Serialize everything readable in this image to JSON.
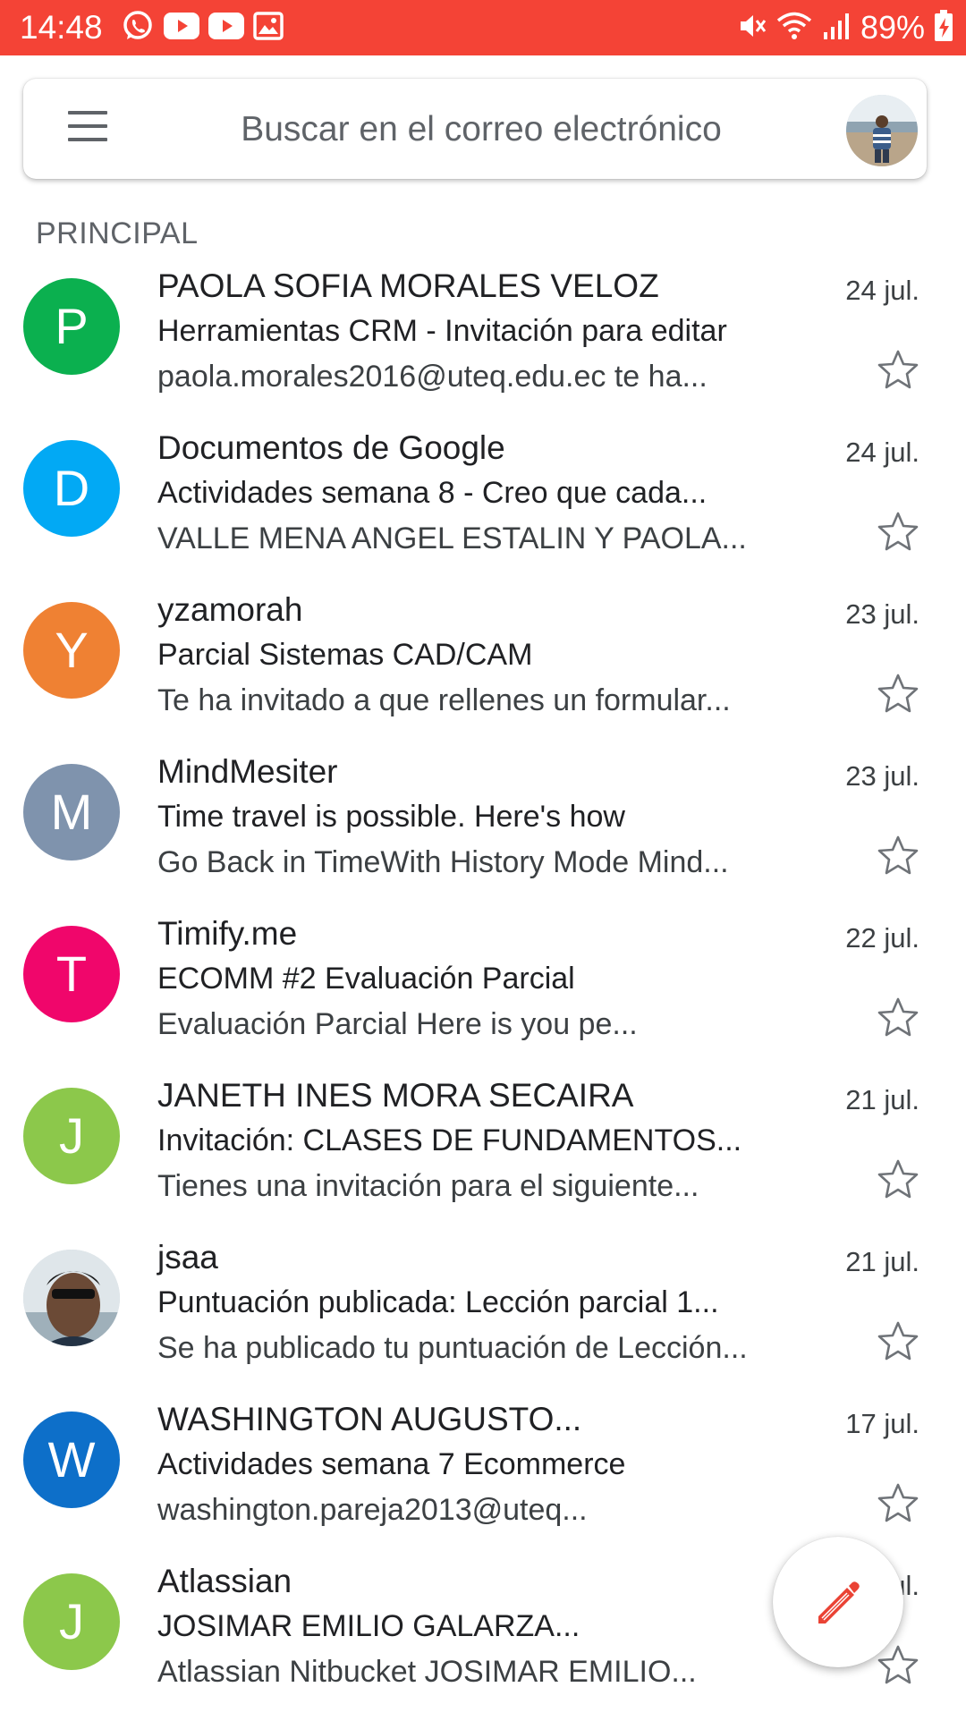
{
  "status_bar": {
    "time": "14:48",
    "battery": "89%",
    "icons": [
      "whatsapp-icon",
      "youtube-icon",
      "youtube-icon",
      "image-icon",
      "mute-icon",
      "wifi-icon",
      "signal-icon",
      "battery-charging-icon"
    ]
  },
  "search": {
    "placeholder": "Buscar en el correo electrónico"
  },
  "section_label": "PRINCIPAL",
  "emails": [
    {
      "initial": "P",
      "color": "#0bb04f",
      "sender": "PAOLA SOFIA MORALES VELOZ",
      "subject": "Herramientas CRM - Invitación para editar",
      "snippet": "paola.morales2016@uteq.edu.ec te ha...",
      "date": "24 jul."
    },
    {
      "initial": "D",
      "color": "#02a9f4",
      "sender": "Documentos de Google",
      "subject": "Actividades semana 8 - Creo que cada...",
      "snippet": "VALLE MENA ANGEL ESTALIN Y PAOLA...",
      "date": "24 jul."
    },
    {
      "initial": "Y",
      "color": "#ef8133",
      "sender": "yzamorah",
      "subject": "Parcial Sistemas CAD/CAM",
      "snippet": "Te ha invitado a que rellenes un formular...",
      "date": "23 jul."
    },
    {
      "initial": "M",
      "color": "#7f93ad",
      "sender": "MindMesiter",
      "subject": "Time travel is possible. Here's how",
      "snippet": "Go Back in TimeWith History Mode Mind...",
      "date": "23 jul."
    },
    {
      "initial": "T",
      "color": "#f0066b",
      "sender": "Timify.me",
      "subject": "ECOMM #2 Evaluación Parcial",
      "snippet": "Evaluación Parcial Here is you pe...",
      "date": "22 jul."
    },
    {
      "initial": "J",
      "color": "#8cc84b",
      "sender": "JANETH INES MORA SECAIRA",
      "subject": "Invitación: CLASES DE FUNDAMENTOS...",
      "snippet": "Tienes una invitación para el siguiente...",
      "date": "21 jul."
    },
    {
      "initial": "",
      "color": "#cfd6dc",
      "photo": true,
      "sender": "jsaa",
      "subject": "Puntuación publicada: Lección parcial 1...",
      "snippet": "Se ha publicado tu puntuación de Lección...",
      "date": "21 jul."
    },
    {
      "initial": "W",
      "color": "#0d6fc9",
      "sender": "WASHINGTON AUGUSTO...",
      "subject": "Actividades semana 7 Ecommerce",
      "snippet": "washington.pareja2013@uteq...",
      "date": "17 jul."
    },
    {
      "initial": "J",
      "color": "#8cc84b",
      "sender": "Atlassian",
      "subject": "JOSIMAR EMILIO GALARZA...",
      "snippet": "Atlassian Nitbucket JOSIMAR EMILIO...",
      "date": "16 jul."
    }
  ],
  "fab_icon": "pencil-icon"
}
